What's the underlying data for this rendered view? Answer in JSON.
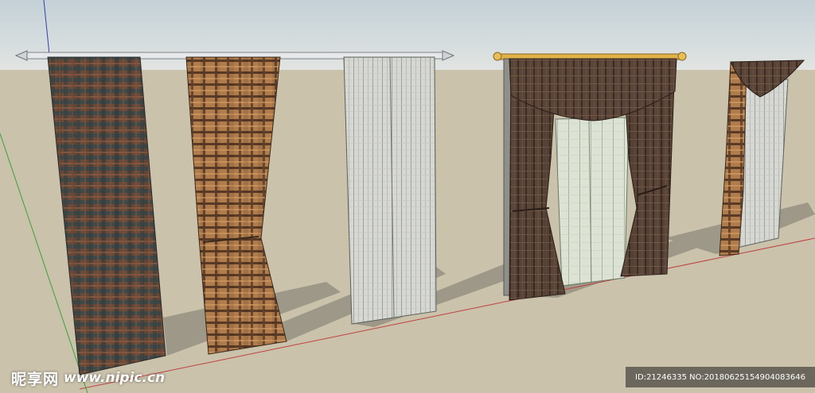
{
  "scene": {
    "colors": {
      "sky_top": "#c4d1d7",
      "sky_bottom": "#e1e4e2",
      "ground": "#cac2ab",
      "shadow": "#8f8a7c",
      "axis_red": "#c04040",
      "axis_green": "#3aa33a",
      "axis_blue": "#3040b0"
    },
    "objects": [
      {
        "name": "plaid-curtain-dark",
        "pattern": "plaid-dark"
      },
      {
        "name": "plaid-curtain-tan-tied",
        "pattern": "plaid-tan"
      },
      {
        "name": "sheer-curtain-white",
        "pattern": "sheer"
      },
      {
        "name": "valance-curtain-brown-with-sheer",
        "pattern": "brown-weave"
      },
      {
        "name": "small-valance-curtain",
        "pattern": "brown-weave"
      }
    ]
  },
  "watermark": {
    "brand": "昵享网",
    "url": "www.nipic.cn",
    "id_text": "ID:21246335 NO:20180625154904083646"
  }
}
